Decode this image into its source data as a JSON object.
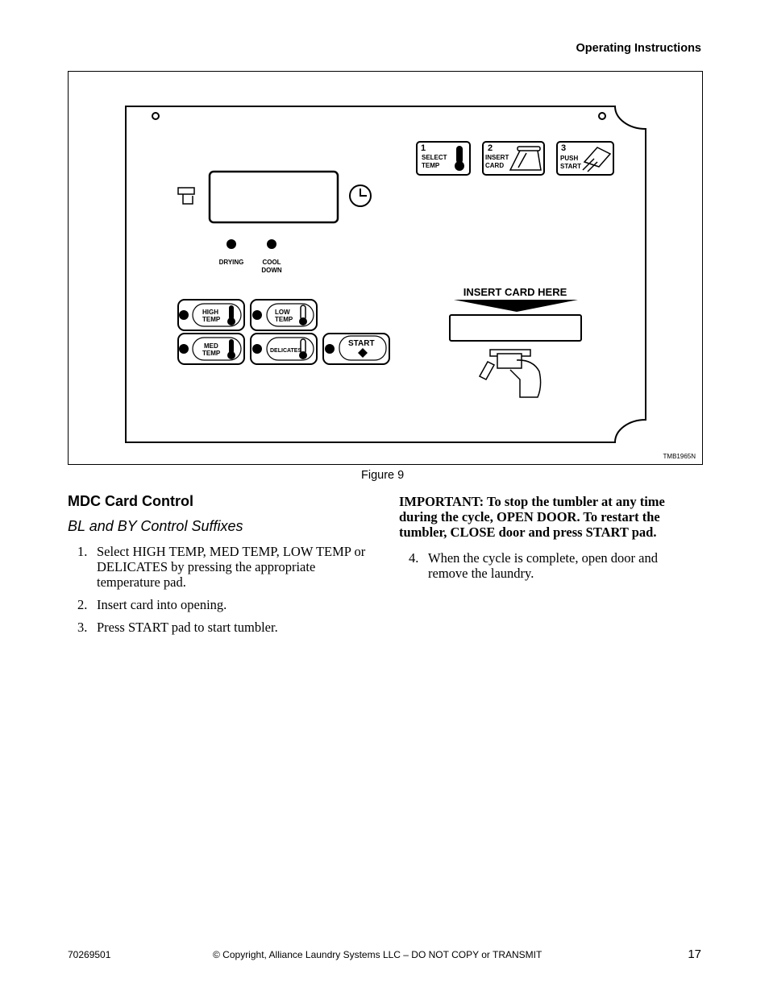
{
  "header": {
    "section": "Operating Instructions"
  },
  "figure": {
    "caption": "Figure 9",
    "code": "TMB1965N",
    "panel": {
      "steps": [
        {
          "number": "1",
          "line1": "SELECT",
          "line2": "TEMP",
          "icon": "thermometer-icon"
        },
        {
          "number": "2",
          "line1": "INSERT",
          "line2": "CARD",
          "icon": "card-slot-icon"
        },
        {
          "number": "3",
          "line1": "PUSH",
          "line2": "START",
          "icon": "hand-press-icon"
        }
      ],
      "indicators": [
        {
          "line1": "DRYING",
          "line2": ""
        },
        {
          "line1": "COOL",
          "line2": "DOWN"
        }
      ],
      "buttons": {
        "high_temp": [
          "HIGH",
          "TEMP"
        ],
        "low_temp": [
          "LOW",
          "TEMP"
        ],
        "med_temp": [
          "MED",
          "TEMP"
        ],
        "delicates": "DELICATES",
        "start": "START"
      },
      "insert_card_label": "INSERT CARD HERE"
    }
  },
  "section": {
    "title": "MDC Card Control",
    "subtitle": "BL and BY Control Suffixes",
    "steps_left": [
      {
        "num": "1.",
        "text": "Select HIGH TEMP, MED TEMP, LOW TEMP or DELICATES by pressing the appropriate temperature pad."
      },
      {
        "num": "2.",
        "text": "Insert card into opening."
      },
      {
        "num": "3.",
        "text": "Press START pad to start tumbler."
      }
    ],
    "important": "IMPORTANT: To stop the tumbler at any time during the cycle, OPEN DOOR. To restart the tumbler, CLOSE door and press START pad.",
    "steps_right": [
      {
        "num": "4.",
        "text": "When the cycle is complete, open door and remove the laundry."
      }
    ]
  },
  "footer": {
    "doc_number": "70269501",
    "copyright": "© Copyright, Alliance Laundry Systems LLC – DO NOT COPY or TRANSMIT",
    "page": "17"
  }
}
